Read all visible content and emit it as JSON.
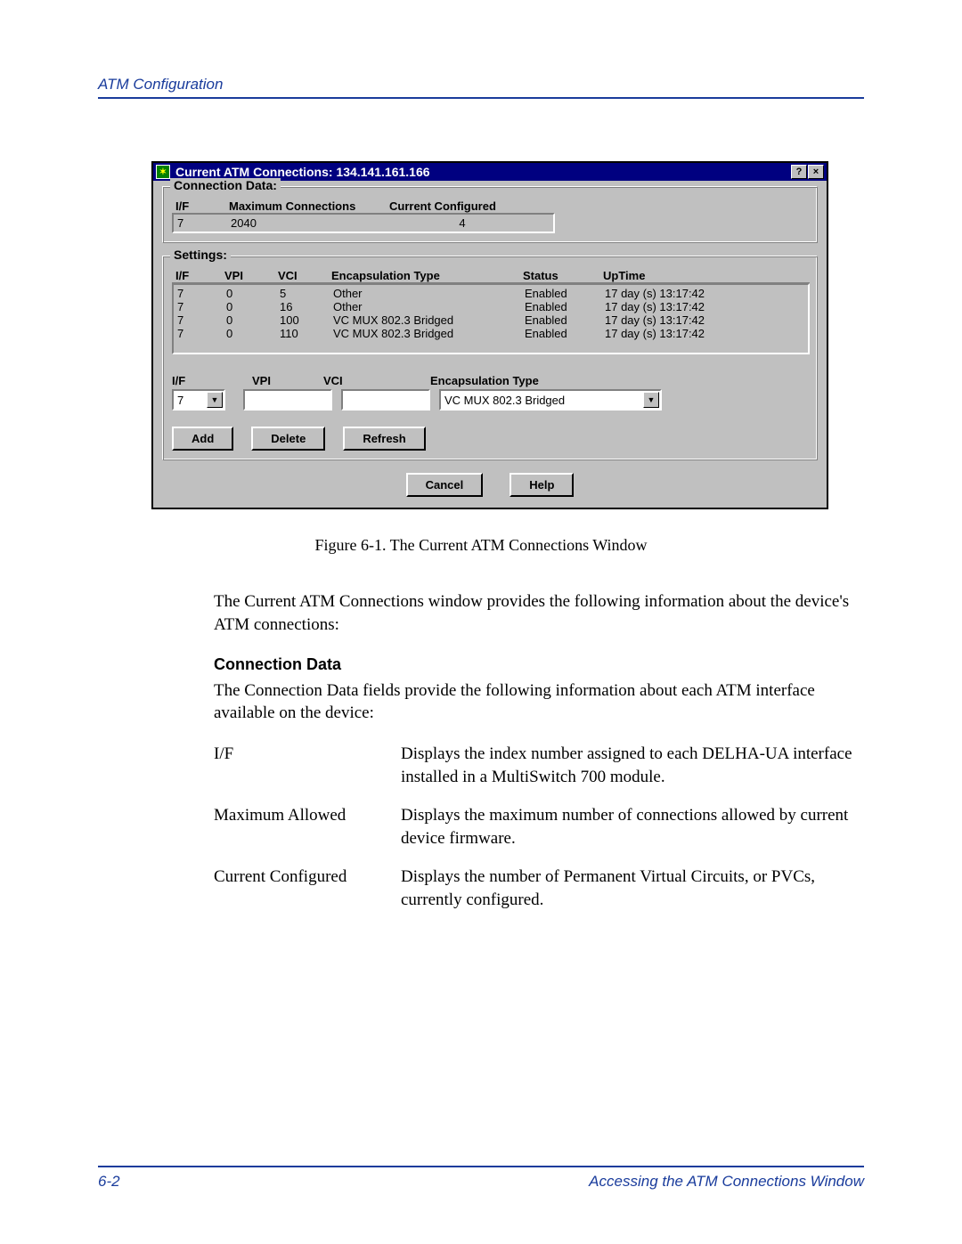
{
  "header": {
    "title": "ATM Configuration"
  },
  "window": {
    "title": "Current ATM Connections: 134.141.161.166",
    "help_btn": "?",
    "close_btn": "×",
    "connection_data": {
      "legend": "Connection Data:",
      "headers": {
        "if": "I/F",
        "max": "Maximum Connections",
        "cur": "Current Configured"
      },
      "row": {
        "if": "7",
        "max": "2040",
        "cur": "4"
      }
    },
    "settings": {
      "legend": "Settings:",
      "headers": {
        "if": "I/F",
        "vpi": "VPI",
        "vci": "VCI",
        "encap": "Encapsulation Type",
        "status": "Status",
        "uptime": "UpTime"
      },
      "rows": [
        {
          "if": "7",
          "vpi": "0",
          "vci": "5",
          "encap": "Other",
          "status": "Enabled",
          "uptime": "17 day (s) 13:17:42"
        },
        {
          "if": "7",
          "vpi": "0",
          "vci": "16",
          "encap": "Other",
          "status": "Enabled",
          "uptime": "17 day (s) 13:17:42"
        },
        {
          "if": "7",
          "vpi": "0",
          "vci": "100",
          "encap": "VC MUX 802.3 Bridged",
          "status": "Enabled",
          "uptime": "17 day (s) 13:17:42"
        },
        {
          "if": "7",
          "vpi": "0",
          "vci": "110",
          "encap": "VC MUX 802.3 Bridged",
          "status": "Enabled",
          "uptime": "17 day (s) 13:17:42"
        }
      ],
      "edit_labels": {
        "if": "I/F",
        "vpi": "VPI",
        "vci": "VCI",
        "encap": "Encapsulation Type"
      },
      "edit_values": {
        "if": "7",
        "encap": "VC MUX 802.3 Bridged"
      },
      "buttons": {
        "add": "Add",
        "delete": "Delete",
        "refresh": "Refresh"
      }
    },
    "bottom_buttons": {
      "cancel": "Cancel",
      "help": "Help"
    }
  },
  "caption": "Figure 6-1. The Current ATM Connections Window",
  "body": {
    "intro": "The Current ATM Connections window provides the following information about the device's ATM connections:",
    "subhead": "Connection Data",
    "subtext": "The Connection Data fields provide the following information about each ATM interface available on the device:",
    "defs": [
      {
        "term": "I/F",
        "def": "Displays the index number assigned to each DELHA-UA interface installed in a MultiSwitch 700 module."
      },
      {
        "term": "Maximum Allowed",
        "def": "Displays the maximum number of connections allowed by current device firmware."
      },
      {
        "term": "Current Configured",
        "def": "Displays the number of Permanent Virtual Circuits, or PVCs, currently configured."
      }
    ]
  },
  "footer": {
    "left": "6-2",
    "right": "Accessing the ATM Connections Window"
  }
}
